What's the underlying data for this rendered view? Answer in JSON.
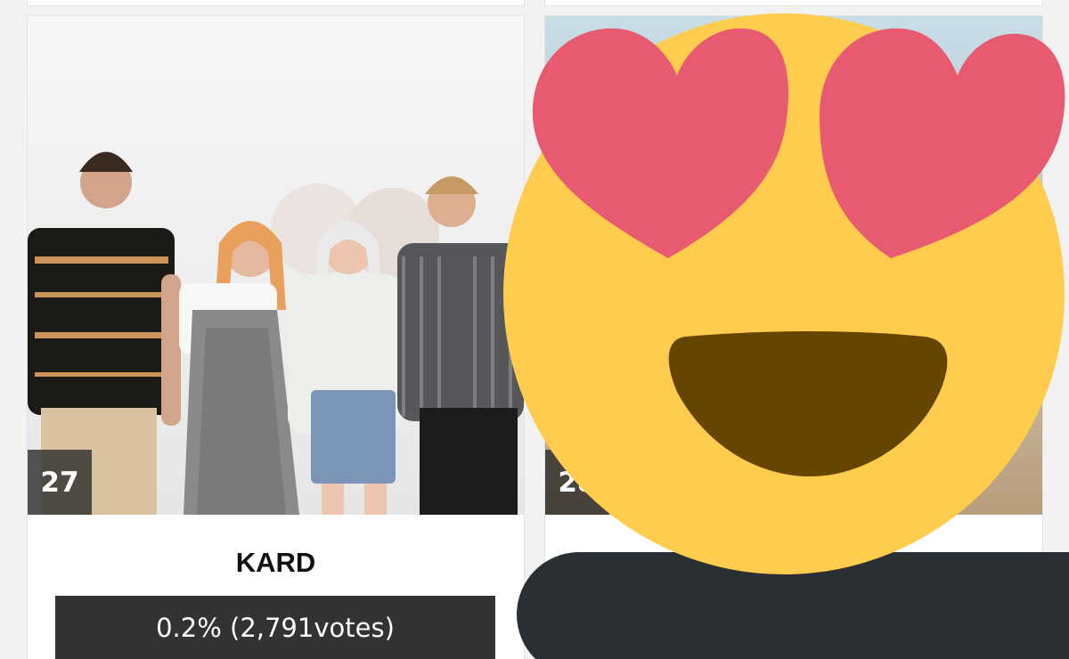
{
  "cards": [
    {
      "rank": "27",
      "artist": "KARD",
      "vote_result": "0.2% (2,791votes)"
    },
    {
      "rank": "28",
      "artist": "",
      "vote_result": ""
    }
  ],
  "overlay": {
    "emoji": "heart-eyes-smiling-face-icon",
    "face_color": "#FFCC4D",
    "heart_color": "#E75A70",
    "mouth_color": "#664500",
    "bar_color": "#292F33"
  },
  "colors": {
    "rank_badge_bg": "#333333",
    "vote_bar_bg": "#333333",
    "card_bg": "#FFFFFF"
  }
}
